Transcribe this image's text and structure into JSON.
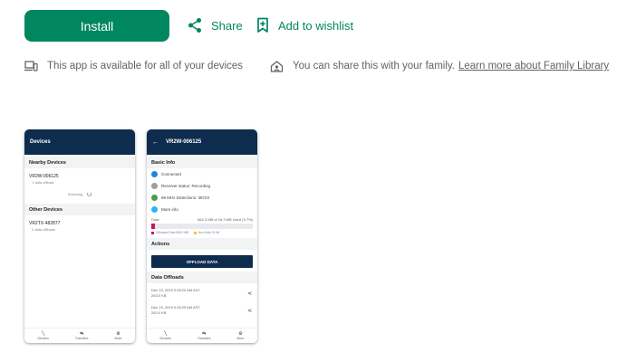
{
  "actions": {
    "install_label": "Install",
    "share_label": "Share",
    "wishlist_label": "Add to wishlist"
  },
  "info": {
    "devices_text": "This app is available for all of your devices",
    "family_text": "You can share this with your family.",
    "family_link": "Learn more about Family Library"
  },
  "colors": {
    "accent": "#01875f",
    "app_header": "#0e2c4e"
  },
  "screenshot1": {
    "header": "Devices",
    "nearby_section": "Nearby Devices",
    "nearby_name": "VR2W-006125",
    "nearby_sub": "1 data offload",
    "scanning": "Scanning",
    "other_section": "Other Devices",
    "other_name": "VR2TX-482877",
    "other_sub": "2 data offloads",
    "nav": [
      "Devices",
      "Transfers",
      "More"
    ]
  },
  "screenshot2": {
    "header": "VR2W-006125",
    "back_icon": "←",
    "basic_section": "Basic Info",
    "rows": [
      {
        "text": "Connected",
        "color": "#1e88e5",
        "icon": "bluetooth-icon"
      },
      {
        "text": "Receiver status: Recording",
        "color": "#9e9e9e",
        "icon": "receiver-icon"
      },
      {
        "text": "69 MHz Detections: 39723",
        "color": "#43a047",
        "icon": "detections-icon"
      },
      {
        "text": "More info",
        "color": "#29b6f6",
        "icon": "info-icon"
      }
    ],
    "data_label": "Data",
    "data_value": "664.3 MB of 16.3 MB Used (3.7%)",
    "data_used_fraction": 0.037,
    "legend_1": "Offloaded Data 688.3 MB",
    "legend_2": "Non-Data 76 KB",
    "actions_section": "Actions",
    "offload_button": "OFFLOAD DATA",
    "offloads_section": "Data Offloads",
    "offloads": [
      {
        "date": "Dec 19, 2019 9:28:29 AM AST",
        "size": "263.0 KB"
      },
      {
        "date": "Dec 19, 2019 9:28:29 AM AST",
        "size": "263.0 KB"
      }
    ],
    "nav": [
      "Devices",
      "Transfers",
      "More"
    ]
  }
}
